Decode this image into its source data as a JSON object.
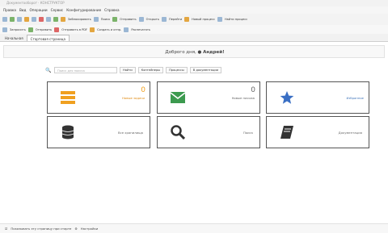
{
  "window": {
    "title": "Документооборот · КОНСТРУКТОР"
  },
  "menubar": {
    "items": [
      "Правка",
      "Вид",
      "Операции",
      "Сервис",
      "Конфигурирование",
      "Справка"
    ]
  },
  "toolbar": {
    "items": [
      "Заблокировать",
      "Поиск",
      "Отправить",
      "Открыть",
      "Перейти",
      "Новый процесс",
      "Найти процесс"
    ],
    "row2": [
      "Запросить",
      "Отправить",
      "Отправить в PDF",
      "Создать и отпр.",
      "Распечатать"
    ]
  },
  "tabs": [
    {
      "label": "Начальная"
    },
    {
      "label": "Стартовая страница"
    }
  ],
  "greeting": {
    "text": "Доброго дня,",
    "user": "Андрей!"
  },
  "search": {
    "placeholder": "Поиск для поиска"
  },
  "search_buttons": [
    "Найти",
    "Контейнеры",
    "Процессы",
    "В документации"
  ],
  "tiles": [
    {
      "name": "new-tasks",
      "count": "0",
      "caption": "Новые задачи"
    },
    {
      "name": "new-letters",
      "count": "0",
      "caption": "Новые письма"
    },
    {
      "name": "favorites",
      "caption": "Избранное"
    },
    {
      "name": "all-storage",
      "caption": "Все хранилища"
    },
    {
      "name": "search",
      "caption": "Поиск"
    },
    {
      "name": "docs",
      "caption": "Документация"
    }
  ],
  "status": {
    "show_on_start": "Показывать эту страницу при старте",
    "settings": "Настройки"
  },
  "colors": {
    "accent": "#f0a020",
    "tile_green": "#3c9a4f",
    "tile_star": "#3a6fc4",
    "tile_dark": "#333333"
  }
}
